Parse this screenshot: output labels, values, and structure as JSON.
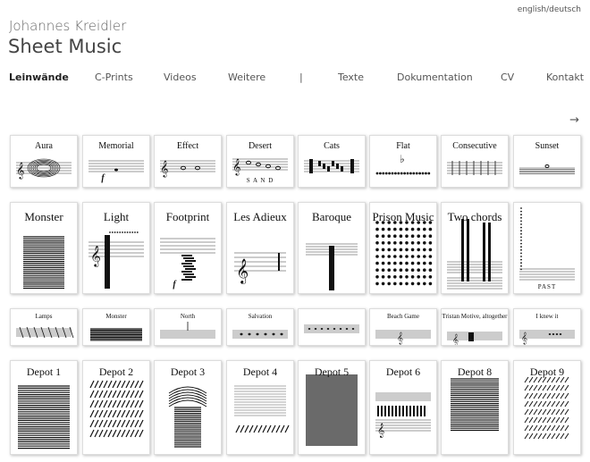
{
  "header": {
    "language_switch": "english/deutsch",
    "author": "Johannes Kreidler",
    "section_title": "Sheet Music"
  },
  "nav": [
    {
      "label": "Leinwände",
      "active": true
    },
    {
      "label": "C-Prints"
    },
    {
      "label": "Videos"
    },
    {
      "label": "Weitere"
    },
    {
      "label": "|"
    },
    {
      "label": "Texte"
    },
    {
      "label": "Dokumentation"
    },
    {
      "label": "CV"
    },
    {
      "label": "Kontakt"
    }
  ],
  "next_arrow": "→",
  "gallery": {
    "row1": [
      {
        "title": "Aura",
        "icon": "aura-score-icon"
      },
      {
        "title": "Memorial",
        "icon": "memorial-score-icon",
        "marking": "f"
      },
      {
        "title": "Effect",
        "icon": "effect-score-icon"
      },
      {
        "title": "Desert",
        "icon": "desert-score-icon",
        "subtitle": "S A N D"
      },
      {
        "title": "Cats",
        "icon": "cats-score-icon"
      },
      {
        "title": "Flat",
        "icon": "flat-score-icon"
      },
      {
        "title": "Consecutive",
        "icon": "consecutive-score-icon"
      },
      {
        "title": "Sunset",
        "icon": "sunset-score-icon"
      }
    ],
    "row2": [
      {
        "title": "Monster",
        "icon": "monster-score-icon"
      },
      {
        "title": "Light",
        "icon": "light-score-icon"
      },
      {
        "title": "Footprint",
        "icon": "footprint-score-icon",
        "marking": "f"
      },
      {
        "title": "Les Adieux",
        "icon": "les-adieux-score-icon"
      },
      {
        "title": "Baroque",
        "icon": "baroque-score-icon"
      },
      {
        "title": "Prison Music",
        "icon": "prison-music-score-icon"
      },
      {
        "title": "Two chords",
        "icon": "two-chords-score-icon"
      },
      {
        "title": "",
        "icon": "past-score-icon",
        "subtitle": "PAST"
      }
    ],
    "row3": [
      {
        "title": "Lamps",
        "icon": "lamps-score-icon"
      },
      {
        "title": "Monster",
        "icon": "monster-small-score-icon"
      },
      {
        "title": "North",
        "icon": "north-score-icon"
      },
      {
        "title": "Salvation",
        "icon": "salvation-score-icon"
      },
      {
        "title": "",
        "icon": "small-score-icon"
      },
      {
        "title": "Beach Game",
        "icon": "beach-game-score-icon"
      },
      {
        "title": "Tristan Motive, altogether",
        "icon": "tristan-score-icon"
      },
      {
        "title": "I knew it",
        "icon": "i-knew-it-score-icon"
      }
    ],
    "row4": [
      {
        "title": "Depot 1",
        "icon": "depot-1-score-icon"
      },
      {
        "title": "Depot 2",
        "icon": "depot-2-score-icon"
      },
      {
        "title": "Depot 3",
        "icon": "depot-3-score-icon"
      },
      {
        "title": "Depot 4",
        "icon": "depot-4-score-icon"
      },
      {
        "title": "Depot 5",
        "icon": "depot-5-score-icon"
      },
      {
        "title": "Depot 6",
        "icon": "depot-6-score-icon"
      },
      {
        "title": "Depot 8",
        "icon": "depot-8-score-icon"
      },
      {
        "title": "Depot 9",
        "icon": "depot-9-score-icon"
      }
    ]
  }
}
